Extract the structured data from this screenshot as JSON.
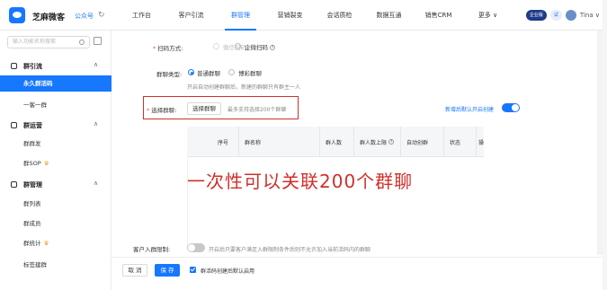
{
  "header": {
    "brand": "芝麻微客",
    "brand_sub": "公众号",
    "nav": [
      "工作台",
      "客户引流",
      "群管理",
      "营销裂变",
      "会话质检",
      "数据互通",
      "销售CRM",
      "更多 ∨"
    ],
    "active_nav": 2,
    "user_badge": "企业版",
    "user_tag": "试",
    "user_name": "Tina ∨"
  },
  "sidebar": {
    "search_placeholder": "输入功能名称搜索",
    "groups": [
      {
        "label": "群引流",
        "items": [
          "永久群活码",
          "一客一群"
        ]
      },
      {
        "label": "群运营",
        "items": [
          "群群发",
          "群SOP"
        ]
      },
      {
        "label": "群管理",
        "items": [
          "群列表",
          "群成员",
          "群统计",
          "标签建群"
        ]
      }
    ],
    "active_item": "永久群活码"
  },
  "form": {
    "scan_label": "扫码方式:",
    "scan_options": [
      "微信扫码",
      "企微扫码"
    ],
    "chat_type_label": "群聊类型:",
    "chat_types": [
      "普通群聊",
      "博彩群聊"
    ],
    "chat_type_hint": "开启自动创建群聊后，新建的群聊只有群主一人",
    "select_label": "选择群聊:",
    "select_button": "选择群聊",
    "select_hint": "最多支持选择200个群聊",
    "auto_create_label": "新增后默认开启创建",
    "table_headers": [
      "序号",
      "群名称",
      "群人数",
      "群人数上限",
      "自动创群",
      "状态",
      "操"
    ],
    "big_caption": "一次性可以关联200个群聊",
    "limit_label": "客户入群限制:",
    "limit_hint": "开启后只要客户满足入群限制条件后则不允许加入当前活码内的群聊"
  },
  "footer": {
    "cancel": "取 消",
    "save": "保 存",
    "checkbox_label": "群活码创建后默认启用"
  }
}
